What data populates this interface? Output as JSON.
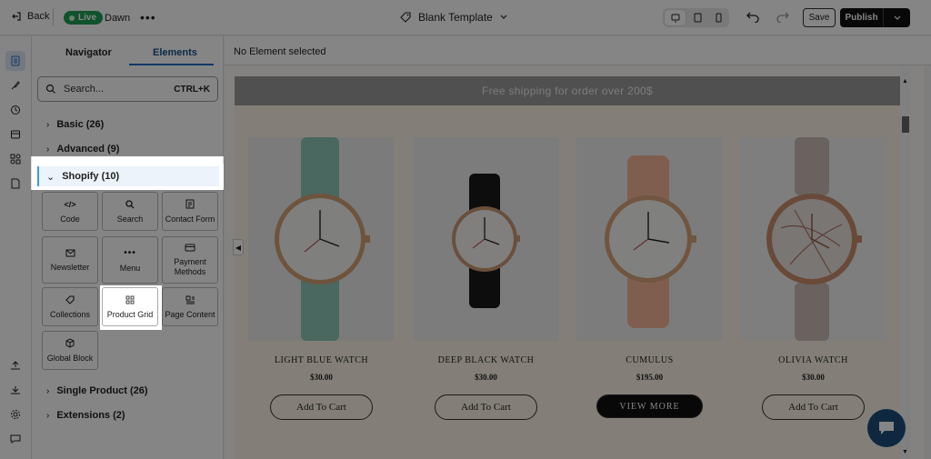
{
  "topbar": {
    "back_label": "Back",
    "live_label": "Live",
    "theme_name": "Dawn",
    "more_label": "•••",
    "template_label": "Blank Template",
    "save_label": "Save",
    "publish_label": "Publish"
  },
  "panel": {
    "tabs": [
      {
        "label": "Navigator"
      },
      {
        "label": "Elements"
      }
    ],
    "search": {
      "placeholder": "Search...",
      "shortcut": "CTRL+K"
    },
    "categories": {
      "basic": "Basic (26)",
      "advanced": "Advanced (9)",
      "shopify": "Shopify (10)",
      "single_product": "Single Product (26)",
      "extensions": "Extensions (2)"
    },
    "elements": [
      {
        "label": "Code",
        "icon": "code-icon"
      },
      {
        "label": "Search",
        "icon": "search-icon"
      },
      {
        "label": "Contact Form",
        "icon": "form-icon"
      },
      {
        "label": "Newsletter",
        "icon": "mail-icon"
      },
      {
        "label": "Menu",
        "icon": "dots-icon"
      },
      {
        "label": "Payment Methods",
        "icon": "payment-icon"
      },
      {
        "label": "Collections",
        "icon": "tag-icon"
      },
      {
        "label": "Product Grid",
        "icon": "grid-icon"
      },
      {
        "label": "Page Content",
        "icon": "page-content-icon"
      },
      {
        "label": "Global Block",
        "icon": "cube-icon"
      }
    ]
  },
  "canvas": {
    "status": "No Element selected",
    "announcement": "Free shipping for order over 200$",
    "products": [
      {
        "name": "LIGHT BLUE WATCH",
        "price": "$30.00",
        "action": "Add To Cart",
        "strap": "#8fc6b9"
      },
      {
        "name": "DEEP BLACK WATCH",
        "price": "$30.00",
        "action": "Add To Cart",
        "strap": "#1a1a1a"
      },
      {
        "name": "CUMULUS",
        "price": "$195.00",
        "action": "VIEW MORE",
        "strap": "#f3b49a"
      },
      {
        "name": "OLIVIA WATCH",
        "price": "$30.00",
        "action": "Add To Cart",
        "strap": "#c9bcb6"
      }
    ]
  },
  "colors": {
    "accent": "#1a6ec0",
    "live_green": "#1f9d55",
    "shopify_bar": "#3aa1d8",
    "chat_bubble": "#1d4d7a"
  }
}
